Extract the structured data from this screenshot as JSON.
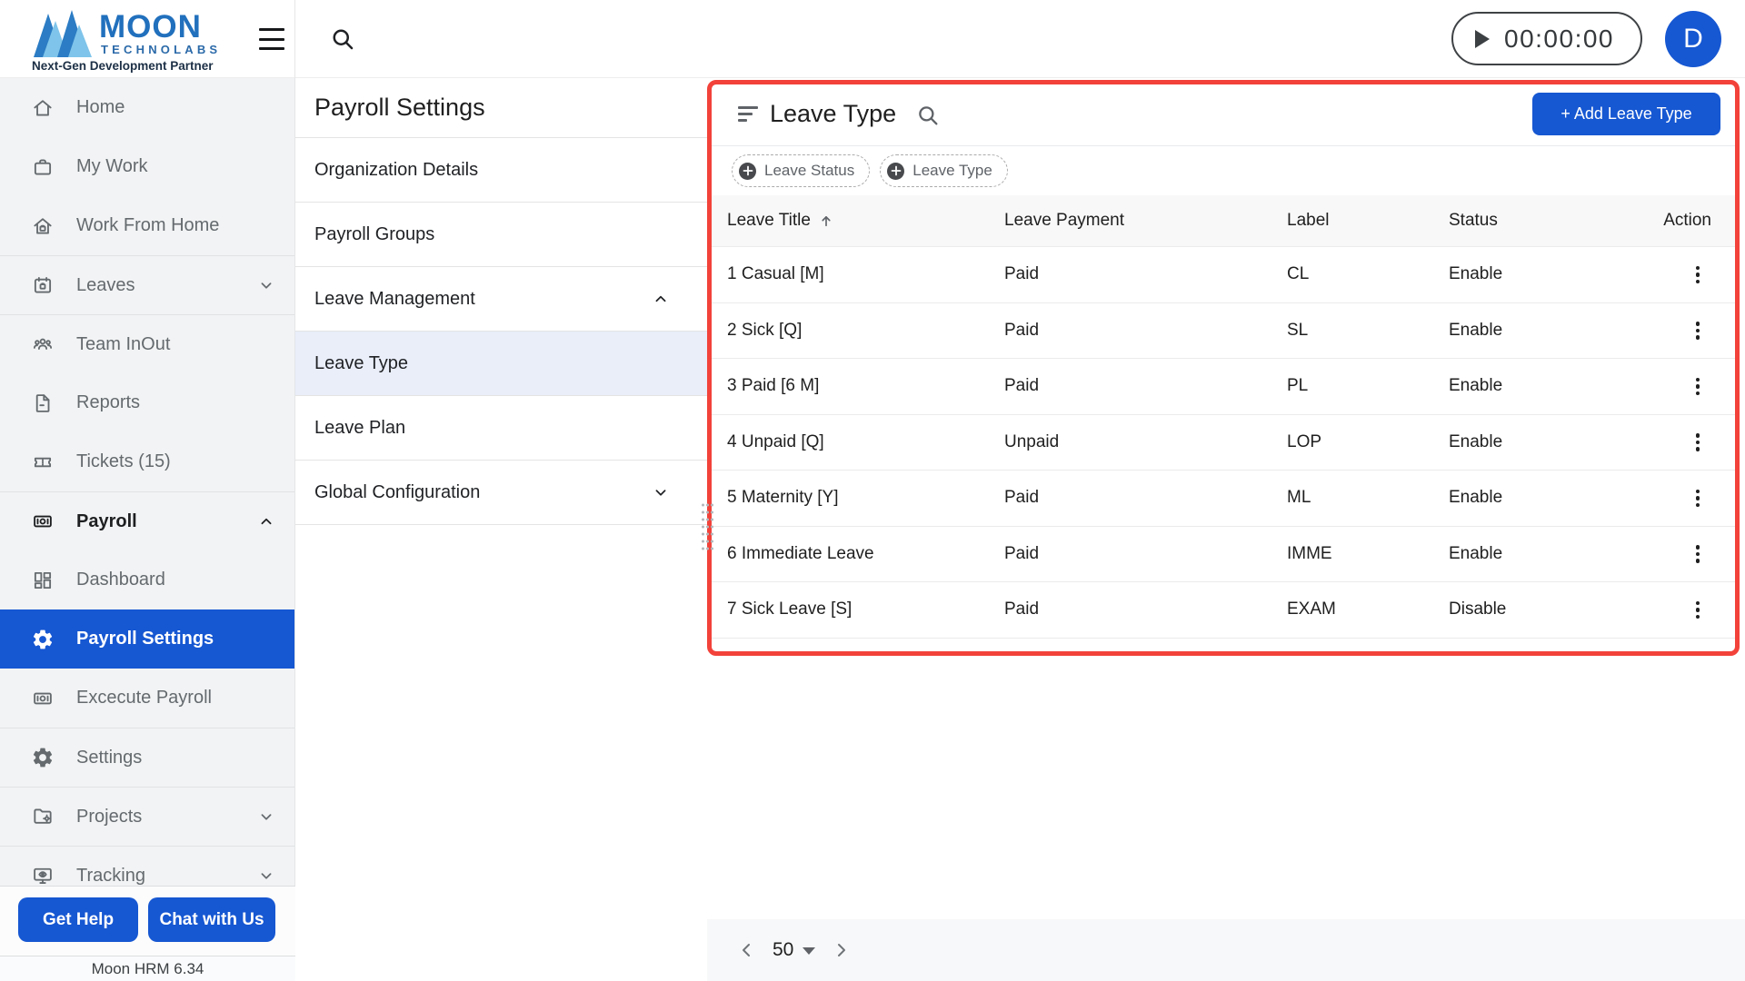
{
  "brand": {
    "word1": "MOON",
    "word2": "TECHNOLABS",
    "tagline": "Next-Gen Development Partner"
  },
  "topbar": {
    "timer": "00:00:00",
    "avatar_initial": "D"
  },
  "sidebar": {
    "items": [
      {
        "label": "Home",
        "icon": "home",
        "sep": false,
        "chevron": null,
        "state": "normal"
      },
      {
        "label": "My Work",
        "icon": "briefcase",
        "sep": false,
        "chevron": null,
        "state": "normal"
      },
      {
        "label": "Work From Home",
        "icon": "house-bag",
        "sep": false,
        "chevron": null,
        "state": "normal"
      },
      {
        "label": "Leaves",
        "icon": "calendar-bag",
        "sep": true,
        "chevron": "down",
        "state": "normal"
      },
      {
        "label": "Team InOut",
        "icon": "people",
        "sep": true,
        "chevron": null,
        "state": "normal"
      },
      {
        "label": "Reports",
        "icon": "document",
        "sep": false,
        "chevron": null,
        "state": "normal"
      },
      {
        "label": "Tickets (15)",
        "icon": "ticket",
        "sep": false,
        "chevron": null,
        "state": "normal"
      },
      {
        "label": "Payroll",
        "icon": "cash",
        "sep": true,
        "chevron": "up",
        "state": "emphasized"
      },
      {
        "label": "Dashboard",
        "icon": "dashboard",
        "sep": false,
        "chevron": null,
        "state": "normal"
      },
      {
        "label": "Payroll Settings",
        "icon": "gear",
        "sep": false,
        "chevron": null,
        "state": "active"
      },
      {
        "label": "Excecute Payroll",
        "icon": "cash",
        "sep": false,
        "chevron": null,
        "state": "normal"
      },
      {
        "label": "Settings",
        "icon": "gear",
        "sep": true,
        "chevron": null,
        "state": "normal"
      },
      {
        "label": "Projects",
        "icon": "folder-gear",
        "sep": true,
        "chevron": "down",
        "state": "normal"
      },
      {
        "label": "Tracking",
        "icon": "monitor-eye",
        "sep": true,
        "chevron": "down",
        "state": "normal"
      }
    ],
    "get_help_label": "Get Help",
    "chat_label": "Chat with Us",
    "version": "Moon HRM 6.34"
  },
  "settings_menu": {
    "title": "Payroll Settings",
    "items": [
      {
        "label": "Organization Details",
        "chevron": null,
        "selected": false
      },
      {
        "label": "Payroll Groups",
        "chevron": null,
        "selected": false
      },
      {
        "label": "Leave Management",
        "chevron": "up",
        "selected": false
      },
      {
        "label": "Leave Type",
        "chevron": null,
        "selected": true
      },
      {
        "label": "Leave Plan",
        "chevron": null,
        "selected": false
      },
      {
        "label": "Global Configuration",
        "chevron": "down",
        "selected": false
      }
    ]
  },
  "content": {
    "title": "Leave Type",
    "add_button_label": "+ Add Leave Type",
    "filter_chips": [
      {
        "label": "Leave Status"
      },
      {
        "label": "Leave Type"
      }
    ],
    "table": {
      "columns": [
        "Leave Title",
        "Leave Payment",
        "Label",
        "Status",
        "Action"
      ],
      "sorted_column": "Leave Title",
      "rows": [
        {
          "title": "1 Casual [M]",
          "payment": "Paid",
          "label": "CL",
          "status": "Enable"
        },
        {
          "title": "2 Sick [Q]",
          "payment": "Paid",
          "label": "SL",
          "status": "Enable"
        },
        {
          "title": "3 Paid [6 M]",
          "payment": "Paid",
          "label": "PL",
          "status": "Enable"
        },
        {
          "title": "4 Unpaid [Q]",
          "payment": "Unpaid",
          "label": "LOP",
          "status": "Enable"
        },
        {
          "title": "5 Maternity [Y]",
          "payment": "Paid",
          "label": "ML",
          "status": "Enable"
        },
        {
          "title": "6 Immediate Leave",
          "payment": "Paid",
          "label": "IMME",
          "status": "Enable"
        },
        {
          "title": "7 Sick Leave [S]",
          "payment": "Paid",
          "label": "EXAM",
          "status": "Disable"
        }
      ]
    },
    "pagination": {
      "page_size": "50"
    }
  },
  "colors": {
    "accent_blue": "#1657d2",
    "selected_row_blue": "#e9eef9",
    "highlight_red_outline": "#f2423a",
    "sidebar_gray": "#f2f3f4"
  }
}
